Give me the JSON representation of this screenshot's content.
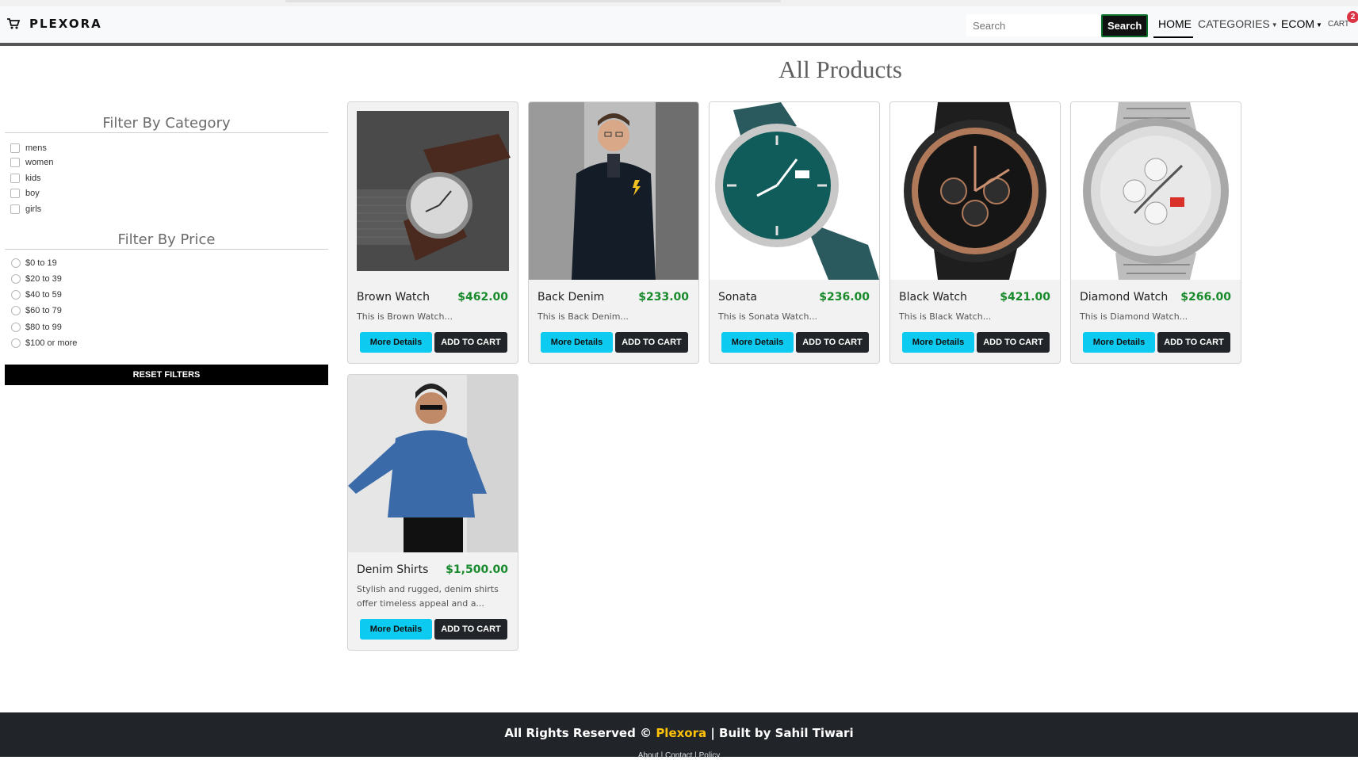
{
  "header": {
    "brand": "PLEXORA",
    "search_placeholder": "Search",
    "search_button": "Search",
    "nav": {
      "home": "HOME",
      "categories": "CATEGORIES",
      "ecom": "ECOM",
      "cart": "CART",
      "cart_count": "2"
    }
  },
  "main": {
    "title": "All Products"
  },
  "filters": {
    "category_title": "Filter By Category",
    "categories": [
      "mens",
      "women",
      "kids",
      "boy",
      "girls"
    ],
    "price_title": "Filter By Price",
    "prices": [
      "$0 to 19",
      "$20 to 39",
      "$40 to 59",
      "$60 to 79",
      "$80 to 99",
      "$100 or more"
    ],
    "reset": "RESET FILTERS"
  },
  "products": [
    {
      "name": "Brown Watch",
      "price": "$462.00",
      "desc": "This is Brown Watch...",
      "image": "watch-brown"
    },
    {
      "name": "Back Denim",
      "price": "$233.00",
      "desc": "This is Back Denim...",
      "image": "man-black-denim"
    },
    {
      "name": "Sonata",
      "price": "$236.00",
      "desc": "This is Sonata Watch...",
      "image": "watch-teal"
    },
    {
      "name": "Black Watch",
      "price": "$421.00",
      "desc": "This is Black Watch...",
      "image": "watch-black"
    },
    {
      "name": "Diamond Watch",
      "price": "$266.00",
      "desc": "This is Diamond Watch...",
      "image": "watch-silver"
    },
    {
      "name": "Denim Shirts",
      "price": "$1,500.00",
      "desc": "Stylish and rugged, denim shirts offer timeless appeal and a...",
      "image": "man-blue-denim"
    }
  ],
  "buttons": {
    "details": "More Details",
    "cart": "ADD TO CART"
  },
  "footer": {
    "prefix": "All Rights Reserved ©",
    "brand": "Plexora",
    "suffix": "| Built by Sahil Tiwari",
    "links": "About | Contact | Policy"
  },
  "colors": {
    "accent_cyan": "#0dcaf0",
    "price_green": "#198a2c",
    "footer_bg": "#212529",
    "brand_yellow": "#ffc107",
    "badge_red": "#dc3545"
  }
}
